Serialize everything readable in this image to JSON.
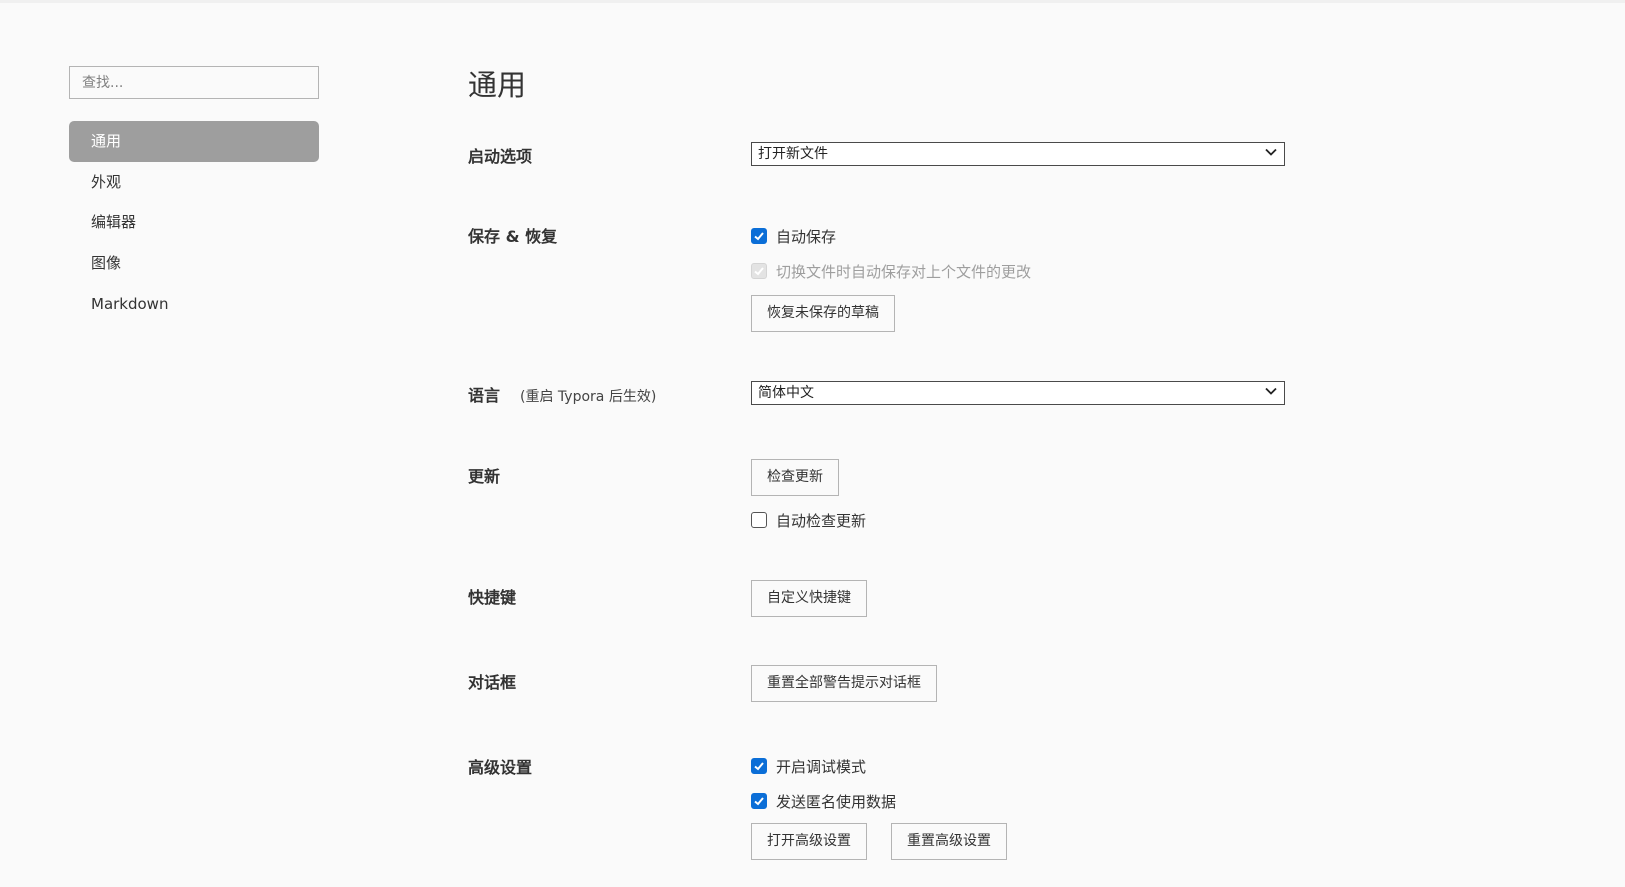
{
  "sidebar": {
    "search_placeholder": "查找...",
    "items": [
      {
        "label": "通用",
        "active": true
      },
      {
        "label": "外观",
        "active": false
      },
      {
        "label": "编辑器",
        "active": false
      },
      {
        "label": "图像",
        "active": false
      },
      {
        "label": "Markdown",
        "active": false
      }
    ]
  },
  "main": {
    "title": "通用",
    "startup": {
      "label": "启动选项",
      "selected": "打开新文件"
    },
    "save_restore": {
      "label": "保存 & 恢复",
      "autosave_label": "自动保存",
      "autosave_checked": true,
      "switch_autosave_label": "切换文件时自动保存对上个文件的更改",
      "switch_autosave_checked": true,
      "switch_autosave_disabled": true,
      "restore_button": "恢复未保存的草稿"
    },
    "language": {
      "label": "语言",
      "note": "(重启 Typora 后生效)",
      "selected": "简体中文"
    },
    "update": {
      "label": "更新",
      "check_button": "检查更新",
      "auto_check_label": "自动检查更新",
      "auto_check_checked": false
    },
    "shortcuts": {
      "label": "快捷键",
      "customize_button": "自定义快捷键"
    },
    "dialogs": {
      "label": "对话框",
      "reset_button": "重置全部警告提示对话框"
    },
    "advanced": {
      "label": "高级设置",
      "debug_label": "开启调试模式",
      "debug_checked": true,
      "anon_label": "发送匿名使用数据",
      "anon_checked": true,
      "open_button": "打开高级设置",
      "reset_button": "重置高级设置"
    }
  },
  "colors": {
    "accent": "#0b6ed7",
    "active_nav": "#9e9e9e",
    "background": "#fafafa"
  }
}
